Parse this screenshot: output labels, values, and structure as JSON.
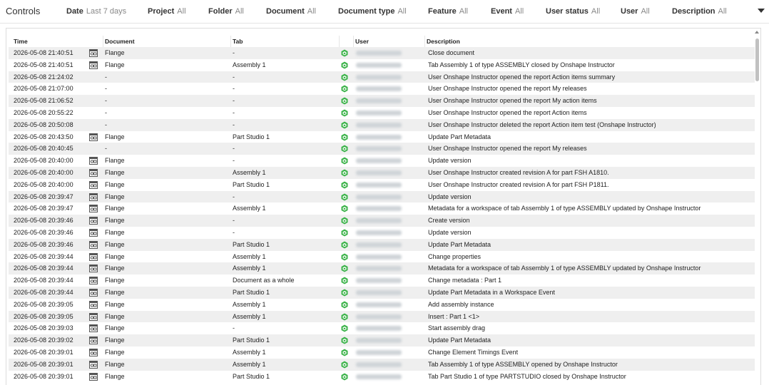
{
  "controls": {
    "title": "Controls",
    "filters": [
      {
        "label": "Date",
        "value": "Last 7 days"
      },
      {
        "label": "Project",
        "value": "All"
      },
      {
        "label": "Folder",
        "value": "All"
      },
      {
        "label": "Document",
        "value": "All"
      },
      {
        "label": "Document type",
        "value": "All"
      },
      {
        "label": "Feature",
        "value": "All"
      },
      {
        "label": "Event",
        "value": "All"
      },
      {
        "label": "User status",
        "value": "All"
      },
      {
        "label": "User",
        "value": "All"
      },
      {
        "label": "Description",
        "value": "All"
      }
    ],
    "expand_icon": "chevron-down-icon"
  },
  "table": {
    "columns": [
      "Time",
      "Document",
      "Tab",
      "User",
      "Description"
    ],
    "doc_icon": "document-icon",
    "user_icon": "onshape-cube-icon",
    "user_icon_color": "#3cb34a",
    "row_stripe_color": "#efefef",
    "rows": [
      {
        "time": "2026-05-08 21:40:51",
        "document": "Flange",
        "tab": "-",
        "description": "Close document"
      },
      {
        "time": "2026-05-08 21:40:51",
        "document": "Flange",
        "tab": "Assembly 1",
        "description": "Tab Assembly 1 of type ASSEMBLY closed by Onshape Instructor"
      },
      {
        "time": "2026-05-08 21:24:02",
        "document": "-",
        "tab": "-",
        "description": "User Onshape Instructor opened the report Action items summary"
      },
      {
        "time": "2026-05-08 21:07:00",
        "document": "-",
        "tab": "-",
        "description": "User Onshape Instructor opened the report My releases"
      },
      {
        "time": "2026-05-08 21:06:52",
        "document": "-",
        "tab": "-",
        "description": "User Onshape Instructor opened the report My action items"
      },
      {
        "time": "2026-05-08 20:55:22",
        "document": "-",
        "tab": "-",
        "description": "User Onshape Instructor opened the report Action items"
      },
      {
        "time": "2026-05-08 20:50:08",
        "document": "-",
        "tab": "-",
        "description": "User Onshape Instructor deleted the report Action item test (Onshape Instructor)"
      },
      {
        "time": "2026-05-08 20:43:50",
        "document": "Flange",
        "tab": "Part Studio 1",
        "description": "Update Part Metadata"
      },
      {
        "time": "2026-05-08 20:40:45",
        "document": "-",
        "tab": "-",
        "description": "User Onshape Instructor opened the report My releases"
      },
      {
        "time": "2026-05-08 20:40:00",
        "document": "Flange",
        "tab": "-",
        "description": "Update version"
      },
      {
        "time": "2026-05-08 20:40:00",
        "document": "Flange",
        "tab": "Assembly 1",
        "description": "User Onshape Instructor created revision A for part FSH A1810."
      },
      {
        "time": "2026-05-08 20:40:00",
        "document": "Flange",
        "tab": "Part Studio 1",
        "description": "User Onshape Instructor created revision A for part FSH P1811."
      },
      {
        "time": "2026-05-08 20:39:47",
        "document": "Flange",
        "tab": "-",
        "description": "Update version"
      },
      {
        "time": "2026-05-08 20:39:47",
        "document": "Flange",
        "tab": "Assembly 1",
        "description": "Metadata for a workspace of tab Assembly 1 of type ASSEMBLY updated by Onshape Instructor"
      },
      {
        "time": "2026-05-08 20:39:46",
        "document": "Flange",
        "tab": "-",
        "description": "Create version"
      },
      {
        "time": "2026-05-08 20:39:46",
        "document": "Flange",
        "tab": "-",
        "description": "Update version"
      },
      {
        "time": "2026-05-08 20:39:46",
        "document": "Flange",
        "tab": "Part Studio 1",
        "description": "Update Part Metadata"
      },
      {
        "time": "2026-05-08 20:39:44",
        "document": "Flange",
        "tab": "Assembly 1",
        "description": "Change properties"
      },
      {
        "time": "2026-05-08 20:39:44",
        "document": "Flange",
        "tab": "Assembly 1",
        "description": "Metadata for a workspace of tab Assembly 1 of type ASSEMBLY updated by Onshape Instructor"
      },
      {
        "time": "2026-05-08 20:39:44",
        "document": "Flange",
        "tab": "Document as a whole",
        "description": "Change metadata : Part 1"
      },
      {
        "time": "2026-05-08 20:39:44",
        "document": "Flange",
        "tab": "Part Studio 1",
        "description": "Update Part Metadata in a Workspace Event"
      },
      {
        "time": "2026-05-08 20:39:05",
        "document": "Flange",
        "tab": "Assembly 1",
        "description": "Add assembly instance"
      },
      {
        "time": "2026-05-08 20:39:05",
        "document": "Flange",
        "tab": "Assembly 1",
        "description": "Insert : Part 1 <1>"
      },
      {
        "time": "2026-05-08 20:39:03",
        "document": "Flange",
        "tab": "-",
        "description": "Start assembly drag"
      },
      {
        "time": "2026-05-08 20:39:02",
        "document": "Flange",
        "tab": "Part Studio 1",
        "description": "Update Part Metadata"
      },
      {
        "time": "2026-05-08 20:39:01",
        "document": "Flange",
        "tab": "Assembly 1",
        "description": "Change Element Timings Event"
      },
      {
        "time": "2026-05-08 20:39:01",
        "document": "Flange",
        "tab": "Assembly 1",
        "description": "Tab Assembly 1 of type ASSEMBLY opened by Onshape Instructor"
      },
      {
        "time": "2026-05-08 20:39:01",
        "document": "Flange",
        "tab": "Part Studio 1",
        "description": "Tab Part Studio 1 of type PARTSTUDIO closed by Onshape Instructor"
      }
    ]
  }
}
